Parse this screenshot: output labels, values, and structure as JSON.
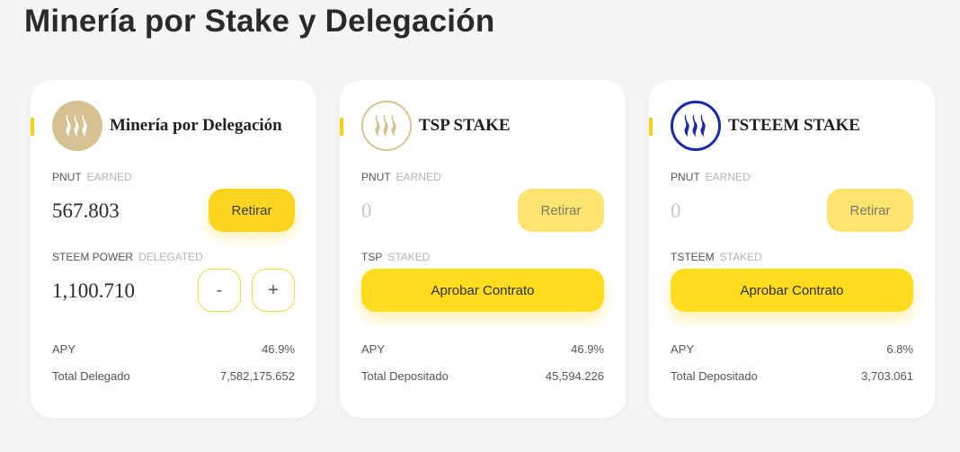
{
  "page": {
    "title": "Minería por Stake y Delegación"
  },
  "colors": {
    "accent": "#fdd520",
    "background": "#f4f5f7",
    "steem_gold": "#d6c190",
    "tsteem_blue": "#1b2aa8"
  },
  "cards": [
    {
      "title": "Minería por Delegación",
      "logo_icon": "steem-logo-icon",
      "earned_token": "PNUT",
      "earned_sub": "EARNED",
      "earned_value": "567.803",
      "withdraw_label": "Retirar",
      "stake_token": "STEEM POWER",
      "stake_sub": "DELEGATED",
      "stake_value": "1,100.710",
      "minus_label": "-",
      "plus_label": "+",
      "apy_label": "APY",
      "apy_value": "46.9%",
      "total_label": "Total Delegado",
      "total_value": "7,582,175.652"
    },
    {
      "title": "TSP STAKE",
      "logo_icon": "tsp-logo-icon",
      "earned_token": "PNUT",
      "earned_sub": "EARNED",
      "earned_value": "0",
      "withdraw_label": "Retirar",
      "stake_token": "TSP",
      "stake_sub": "STAKED",
      "approve_label": "Aprobar Contrato",
      "apy_label": "APY",
      "apy_value": "46.9%",
      "total_label": "Total Depositado",
      "total_value": "45,594.226"
    },
    {
      "title": "TSTEEM STAKE",
      "logo_icon": "tsteem-logo-icon",
      "earned_token": "PNUT",
      "earned_sub": "EARNED",
      "earned_value": "0",
      "withdraw_label": "Retirar",
      "stake_token": "TSTEEM",
      "stake_sub": "STAKED",
      "approve_label": "Aprobar Contrato",
      "apy_label": "APY",
      "apy_value": "6.8%",
      "total_label": "Total Depositado",
      "total_value": "3,703.061"
    }
  ]
}
